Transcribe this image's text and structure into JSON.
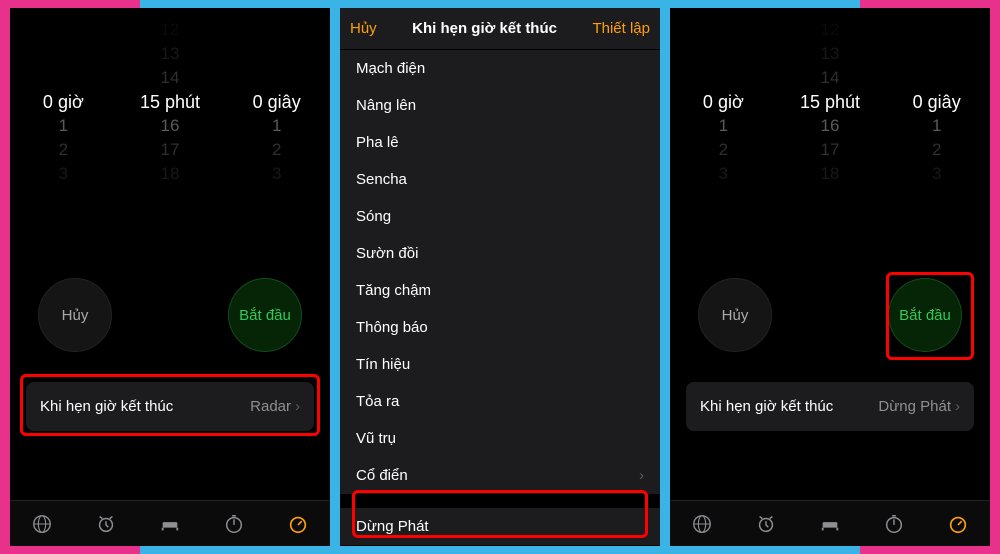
{
  "picker": {
    "hours": {
      "sel": "0",
      "unit": "giờ",
      "r1": "1",
      "r2": "2",
      "r3": "3"
    },
    "mins": {
      "p4": "12",
      "p3": "13",
      "p2": "14",
      "sel": "15",
      "unit": "phút",
      "r1": "16",
      "r2": "17",
      "r3": "18"
    },
    "secs": {
      "sel": "0",
      "unit": "giây",
      "r1": "1",
      "r2": "2",
      "r3": "3"
    }
  },
  "buttons": {
    "cancel": "Hủy",
    "start": "Bắt đầu"
  },
  "endrow": {
    "label": "Khi hẹn giờ kết thúc",
    "value_left": "Radar",
    "value_right": "Dừng Phát"
  },
  "nav": {
    "cancel": "Hủy",
    "title": "Khi hẹn giờ kết thúc",
    "set": "Thiết lập"
  },
  "sounds": [
    "Mạch điện",
    "Nâng lên",
    "Pha lê",
    "Sencha",
    "Sóng",
    "Sườn đồi",
    "Tăng chậm",
    "Thông báo",
    "Tín hiệu",
    "Tỏa ra",
    "Vũ trụ",
    "Cổ điển"
  ],
  "stop": "Dừng Phát"
}
